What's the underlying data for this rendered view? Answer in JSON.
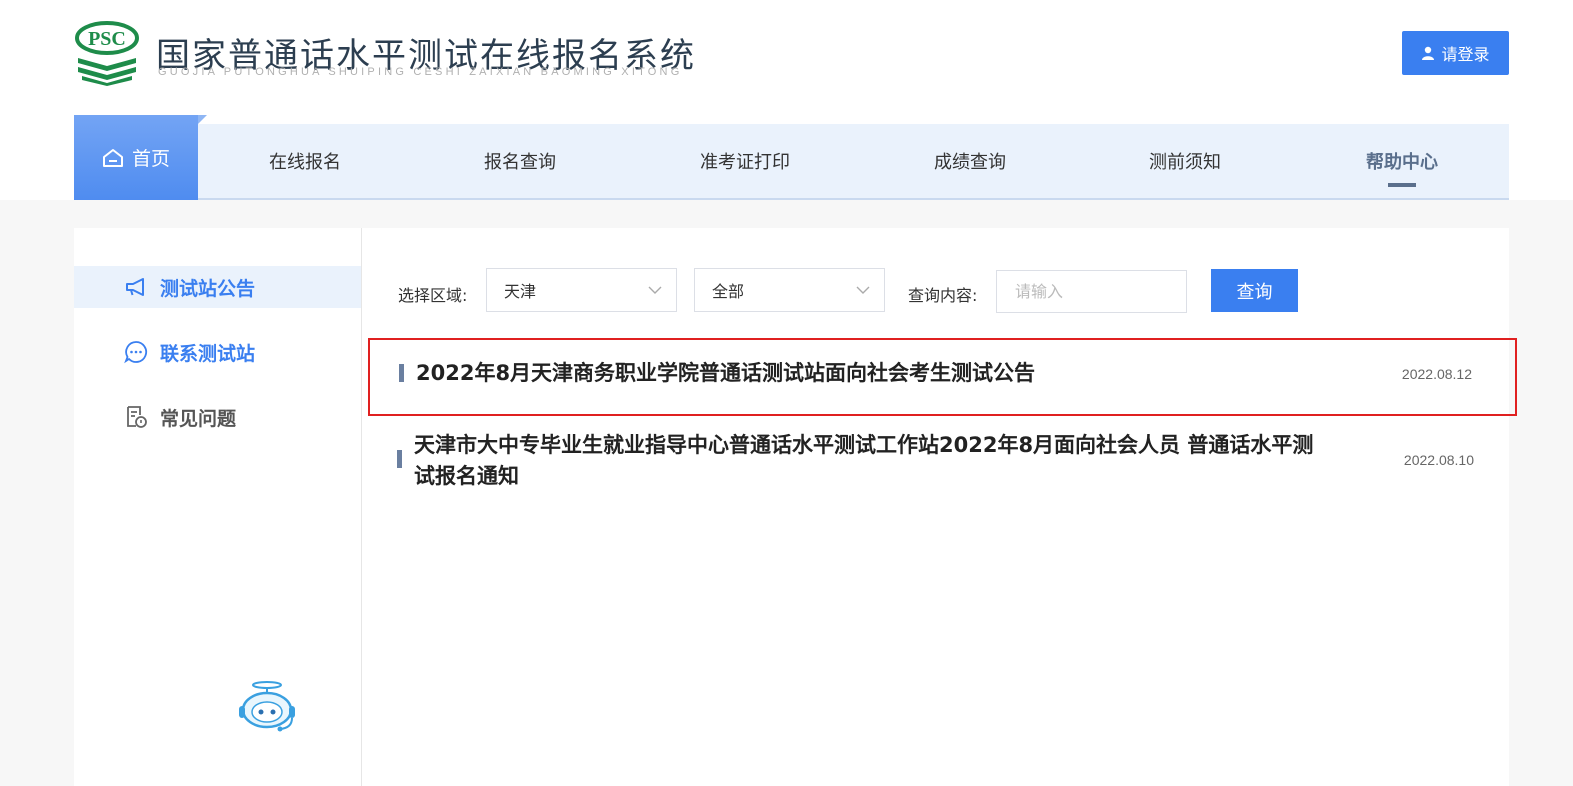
{
  "header": {
    "logo_text": "PSC",
    "title": "国家普通话水平测试在线报名系统",
    "subtitle": "GUOJIA PUTONGHUA SHUIPING CESHI ZAIXIAN BAOMING XITONG",
    "login_label": "请登录"
  },
  "nav": {
    "home": "首页",
    "items": [
      "在线报名",
      "报名查询",
      "准考证打印",
      "成绩查询",
      "测前须知",
      "帮助中心"
    ],
    "active": "帮助中心"
  },
  "sidebar": {
    "items": [
      {
        "label": "测试站公告",
        "icon": "megaphone-icon"
      },
      {
        "label": "联系测试站",
        "icon": "chat-bubble-icon"
      },
      {
        "label": "常见问题",
        "icon": "document-question-icon"
      }
    ]
  },
  "filter": {
    "region_label": "选择区域:",
    "region_value": "天津",
    "category_value": "全部",
    "query_label": "查询内容:",
    "query_placeholder": "请输入",
    "query_button": "查询"
  },
  "notices": [
    {
      "title": "2022年8月天津商务职业学院普通话测试站面向社会考生测试公告",
      "date": "2022.08.12"
    },
    {
      "title": "天津市大中专毕业生就业指导中心普通话水平测试工作站2022年8月面向社会人员 普通话水平测试报名通知",
      "date": "2022.08.10"
    }
  ],
  "colors": {
    "accent": "#3a7ff0",
    "highlight_border": "#e02020",
    "nav_bg": "#eaf2fc"
  }
}
